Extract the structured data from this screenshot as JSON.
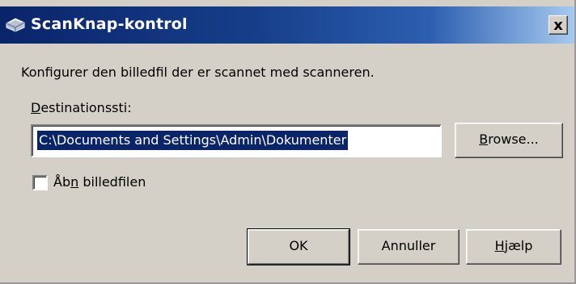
{
  "window": {
    "title": "ScanKnap-kontrol",
    "close_glyph": "x",
    "icon": "scanner-icon"
  },
  "description": "Konfigurer den billedfil der er scannet med scanneren.",
  "destination": {
    "label_underlined": "D",
    "label_rest": "estinationssti:",
    "value": "C:\\Documents and Settings\\Admin\\Dokumenter"
  },
  "browse_button": {
    "label_underlined": "B",
    "label_rest": "rowse..."
  },
  "open_image_checkbox": {
    "checked": false,
    "label_before": "Åb",
    "label_underlined": "n",
    "label_after": " billedfilen"
  },
  "buttons": {
    "ok": "OK",
    "cancel": "Annuller",
    "help_underlined": "H",
    "help_rest": "jælp"
  }
}
